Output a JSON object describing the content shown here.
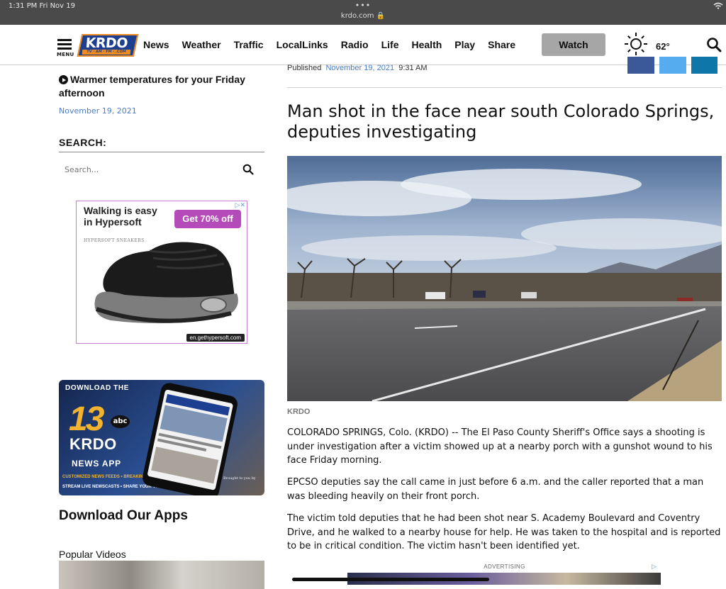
{
  "status_bar": {
    "time": "1:31 PM  Fri Nov 19",
    "dots": "•••",
    "url": "krdo.com 🔒"
  },
  "header": {
    "menu_label": "MENU",
    "logo_text": "KRDO",
    "logo_sub": "TV · AM · FM · .COM",
    "nav": [
      "News",
      "Weather",
      "Traffic",
      "LocalLinks",
      "Radio",
      "Life",
      "Health",
      "Play",
      "Share"
    ],
    "watch_label": "Watch",
    "temperature": "62°",
    "weather_icon": "sun-icon"
  },
  "sidebar": {
    "story_title": "Warmer temperatures for your Friday afternoon",
    "story_date": "November 19, 2021",
    "search_heading": "SEARCH:",
    "search_placeholder": "Search...",
    "ad_shoe": {
      "title": "Walking is easy in Hypersoft",
      "brand": "HYPERSOFT SNEAKERS",
      "offer": "Get 70% off",
      "url": "en.gethypersoft.com"
    },
    "ad_app": {
      "download_the": "DOWNLOAD THE",
      "number": "13",
      "network": "abc",
      "station": "KRDO",
      "app_name": "NEWS APP",
      "features_1": "CUSTOMIZED NEWS FEEDS  •  BREAKING ALERTS",
      "features_2": "STREAM LIVE NEWSCASTS  •  SHARE YOUR VIDEO",
      "brought_by": "Brought to you by"
    },
    "download_apps": "Download Our Apps",
    "popular_videos": "Popular Videos"
  },
  "article": {
    "published_label": "Published",
    "published_date": "November 19, 2021",
    "published_time": "9:31 AM",
    "headline": "Man shot in the face near south Colorado Springs, deputies investigating",
    "image_credit": "KRDO",
    "paragraphs": [
      "COLORADO SPRINGS, Colo. (KRDO) -- The El Paso County Sheriff's Office says a shooting is under investigation after a victim showed up at a nearby porch with a gunshot wound to his face Friday morning.",
      "EPCSO deputies say the call came in just before 6 a.m. and the caller reported that a man was bleeding heavily on their front porch.",
      "The victim told deputies that he had been shot near S. Academy Boulevard and Coventry Drive, and he walked to a nearby house for help. He was taken to the hospital and is reported to be in critical condition. The victim hasn't been identified yet."
    ],
    "advertising_label": "ADVERTISING",
    "social": [
      "facebook-icon",
      "twitter-icon",
      "linkedin-icon"
    ]
  }
}
